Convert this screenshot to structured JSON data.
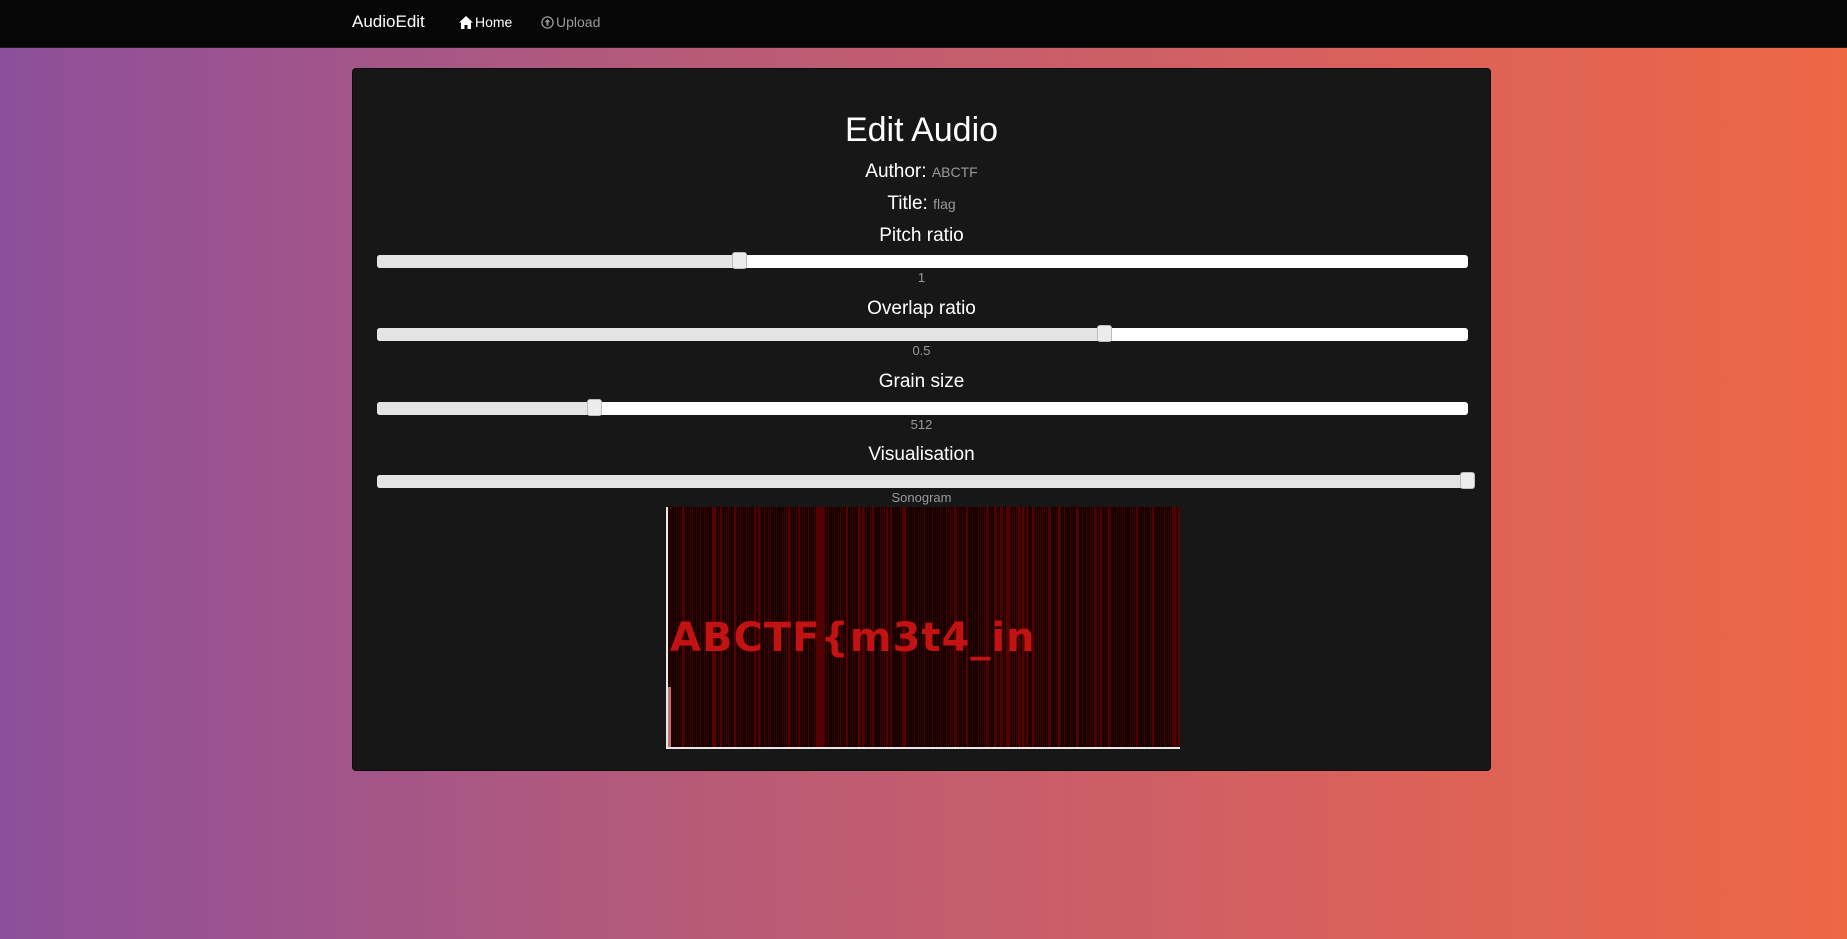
{
  "nav": {
    "brand": "AudioEdit",
    "home_label": "Home",
    "upload_label": "Upload"
  },
  "panel": {
    "title": "Edit Audio",
    "author_label": "Author:",
    "author_value": "ABCTF",
    "title_label": "Title:",
    "title_value": "flag"
  },
  "controls": [
    {
      "label": "Pitch ratio",
      "value_text": "1",
      "position": 0.333
    },
    {
      "label": "Overlap ratio",
      "value_text": "0.5",
      "position": 0.667
    },
    {
      "label": "Grain size",
      "value_text": "512",
      "position": 0.2
    },
    {
      "label": "Visualisation",
      "value_text": "Sonogram",
      "position": 1.0
    }
  ],
  "sonogram": {
    "overlay_text": "ABCTF{m3t4_in",
    "colors": {
      "background": "#100000",
      "lines": "#7a0000",
      "text": "#c31212"
    }
  }
}
